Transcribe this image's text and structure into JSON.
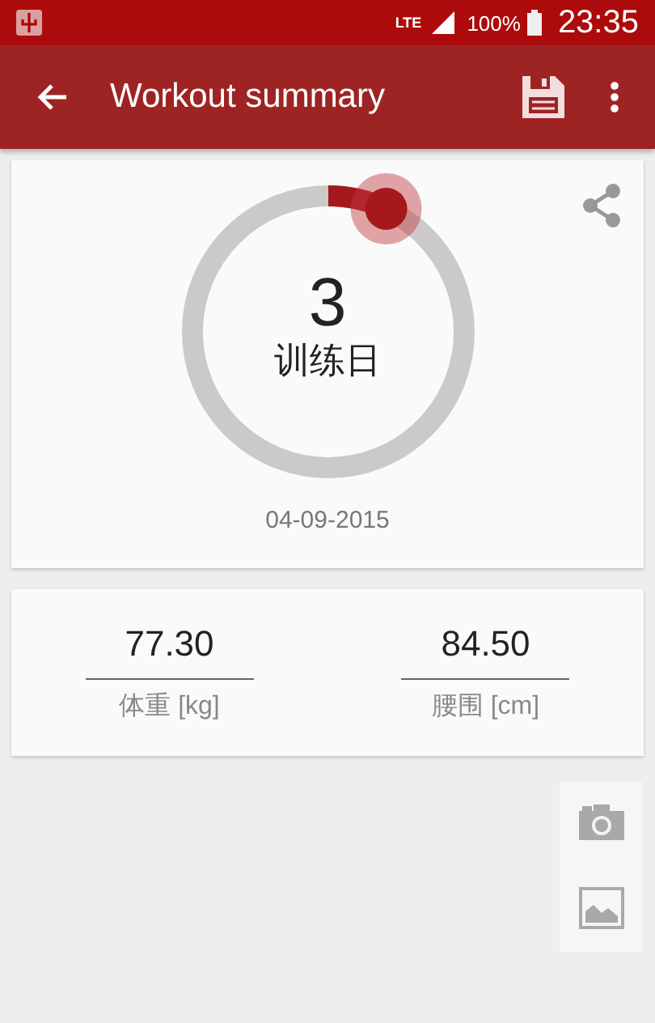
{
  "status_bar": {
    "network": "LTE",
    "battery": "100%",
    "time": "23:35"
  },
  "app_bar": {
    "title": "Workout summary"
  },
  "summary": {
    "count": "3",
    "label": "训练日",
    "level": 0.07,
    "date": "04-09-2015"
  },
  "measurements": [
    {
      "value": "77.30",
      "label": "体重 [kg]"
    },
    {
      "value": "84.50",
      "label": "腰围 [cm]"
    }
  ]
}
